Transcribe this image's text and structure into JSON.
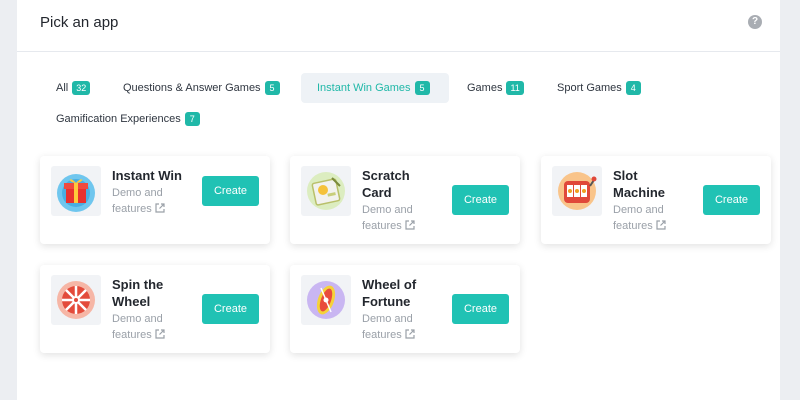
{
  "header": {
    "title": "Pick an app",
    "help_icon": "question-circle-icon"
  },
  "tabs": [
    {
      "label": "All",
      "count": "32",
      "active": false
    },
    {
      "label": "Questions & Answer Games",
      "count": "5",
      "active": false
    },
    {
      "label": "Instant Win Games",
      "count": "5",
      "active": true
    },
    {
      "label": "Games",
      "count": "11",
      "active": false
    },
    {
      "label": "Sport Games",
      "count": "4",
      "active": false
    },
    {
      "label": "Gamification Experiences",
      "count": "7",
      "active": false
    }
  ],
  "apps": [
    {
      "name": "Instant Win",
      "demo_label": "Demo and features",
      "create_label": "Create",
      "icon": "gift-box-icon"
    },
    {
      "name": "Scratch Card",
      "demo_label": "Demo and features",
      "create_label": "Create",
      "icon": "scratch-card-icon"
    },
    {
      "name": "Slot Machine",
      "demo_label": "Demo and features",
      "create_label": "Create",
      "icon": "slot-machine-icon"
    },
    {
      "name": "Spin the Wheel",
      "demo_label": "Demo and features",
      "create_label": "Create",
      "icon": "spin-wheel-icon"
    },
    {
      "name": "Wheel of Fortune",
      "demo_label": "Demo and features",
      "create_label": "Create",
      "icon": "wheel-of-fortune-icon"
    }
  ],
  "colors": {
    "accent": "#20c2b4",
    "badge": "#20b8a8",
    "active_tab_bg": "#eef2f6"
  }
}
